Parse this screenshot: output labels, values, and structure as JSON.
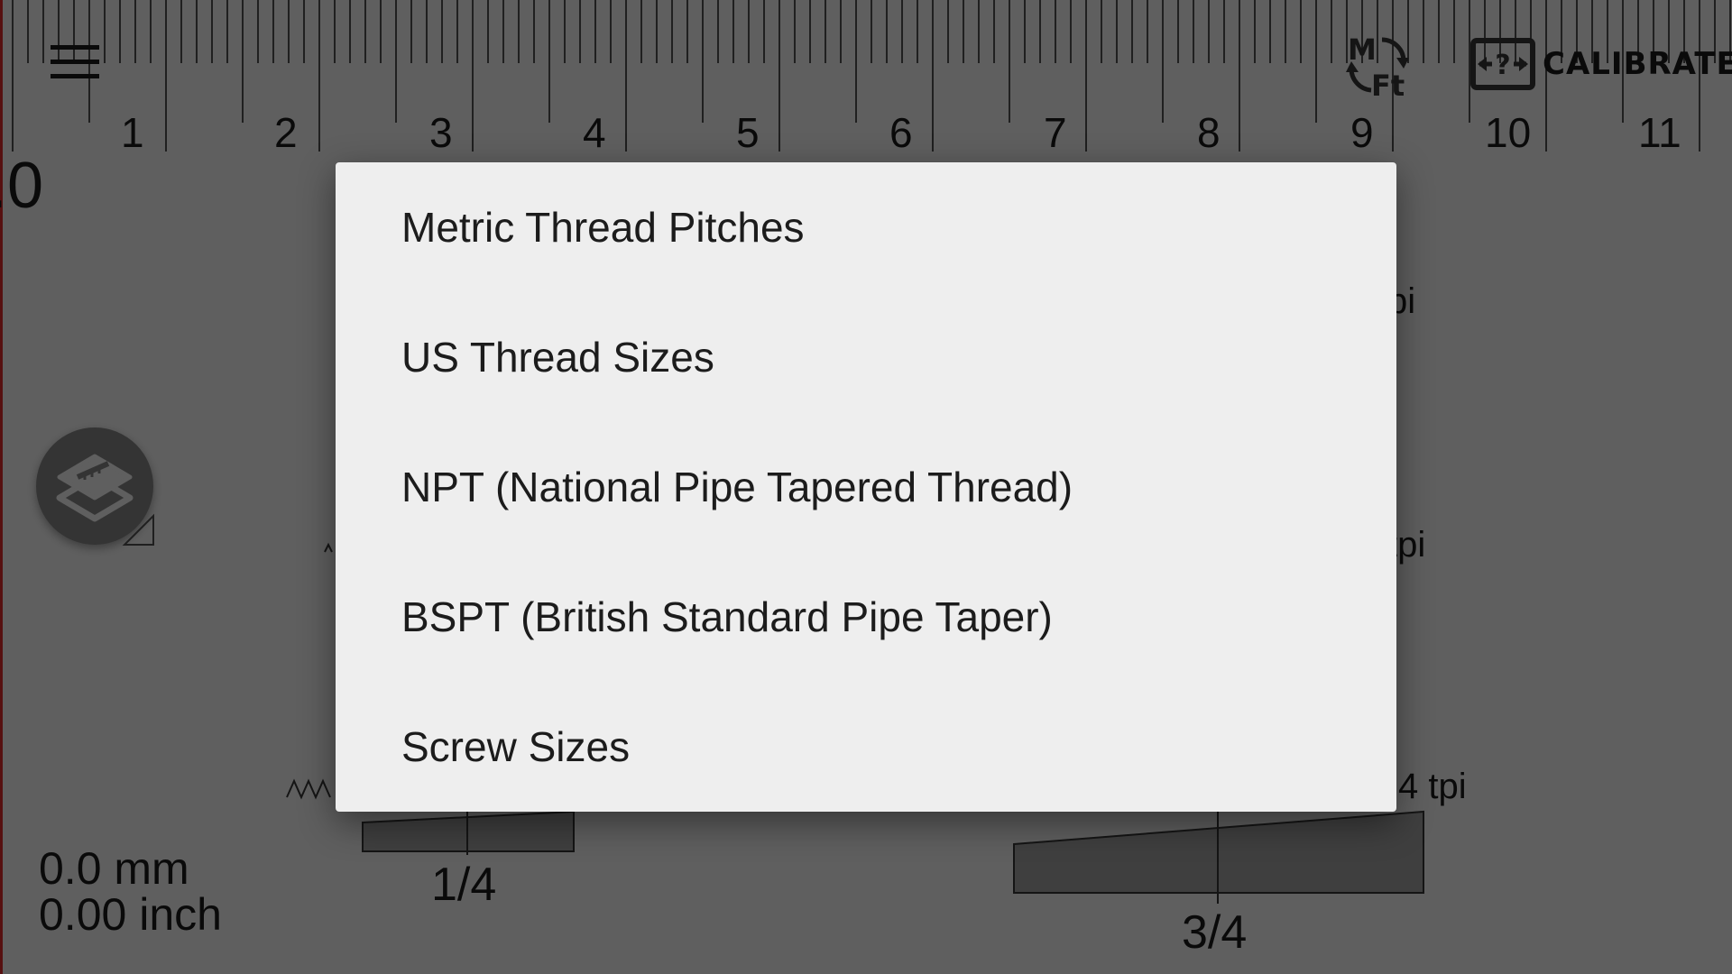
{
  "ruler": {
    "labels": [
      "1",
      "2",
      "3",
      "4",
      "5",
      "6",
      "7",
      "8",
      "9",
      "10",
      "11"
    ]
  },
  "toolbar": {
    "menu_icon": "hamburger-menu-icon",
    "unit_toggle_icon": "metric-feet-toggle-icon",
    "unit_toggle_label_top": "M",
    "unit_toggle_label_bottom": "Ft",
    "calibrate_icon": "calibrate-icon",
    "calibrate_label": "CALIBRATE"
  },
  "background": {
    "partial_value": ".0",
    "tpi_labels": [
      "pi",
      "tpi",
      "4 tpi"
    ],
    "fractions": [
      "1/4",
      "3/4"
    ],
    "fab_icon": "layers-ruler-icon",
    "readout_mm": "0.0 mm",
    "readout_inch": "0.00 inch"
  },
  "dialog": {
    "items": [
      "Metric Thread Pitches",
      "US Thread Sizes",
      "NPT (National Pipe Tapered Thread)",
      "BSPT (British Standard Pipe Taper)",
      "Screw Sizes"
    ]
  },
  "colors": {
    "app_background": "#9a9a9a",
    "dialog_background": "#eeeeee",
    "fab_background": "#555555",
    "left_edge": "#8c1a1a"
  }
}
